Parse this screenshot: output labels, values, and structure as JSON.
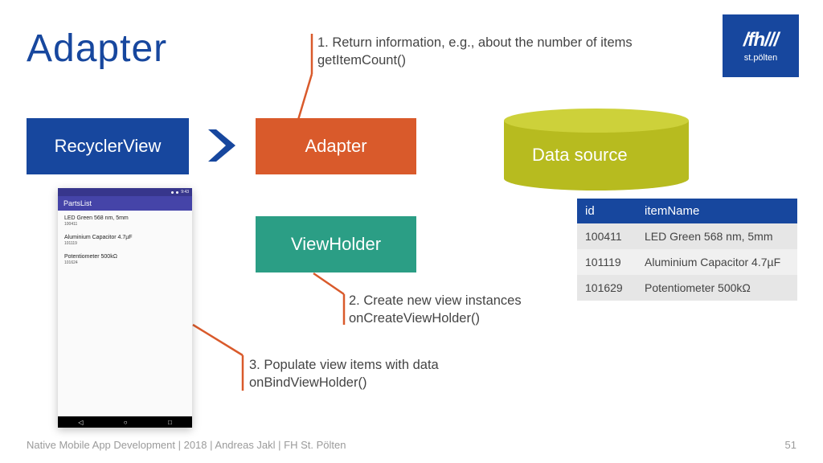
{
  "title": "Adapter",
  "logo": {
    "main": "/fh///",
    "sub": "st.pölten"
  },
  "boxes": {
    "recycler": "RecyclerView",
    "adapter": "Adapter",
    "viewholder": "ViewHolder",
    "datasource": "Data source"
  },
  "notes": {
    "n1a": "1. Return information, e.g., about the number of items",
    "n1b": "getItemCount()",
    "n2a": "2. Create new view instances",
    "n2b": "onCreateViewHolder()",
    "n3a": "3. Populate view items with data",
    "n3b": "onBindViewHolder()"
  },
  "table": {
    "headers": {
      "id": "id",
      "name": "itemName"
    },
    "rows": [
      {
        "id": "100411",
        "name": "LED Green 568 nm, 5mm"
      },
      {
        "id": "101119",
        "name": "Aluminium Capacitor 4.7µF"
      },
      {
        "id": "101629",
        "name": "Potentiometer 500kΩ"
      }
    ]
  },
  "phone": {
    "appname": "PartsList",
    "time": "9:43",
    "items": [
      {
        "t": "LED Green 568 nm, 5mm",
        "s": "100411"
      },
      {
        "t": "Aluminium Capacitor 4.7µF",
        "s": "101119"
      },
      {
        "t": "Potentiometer 500kΩ",
        "s": "101624"
      }
    ]
  },
  "footer": "Native Mobile App Development | 2018 | Andreas Jakl | FH St. Pölten",
  "page": "51"
}
